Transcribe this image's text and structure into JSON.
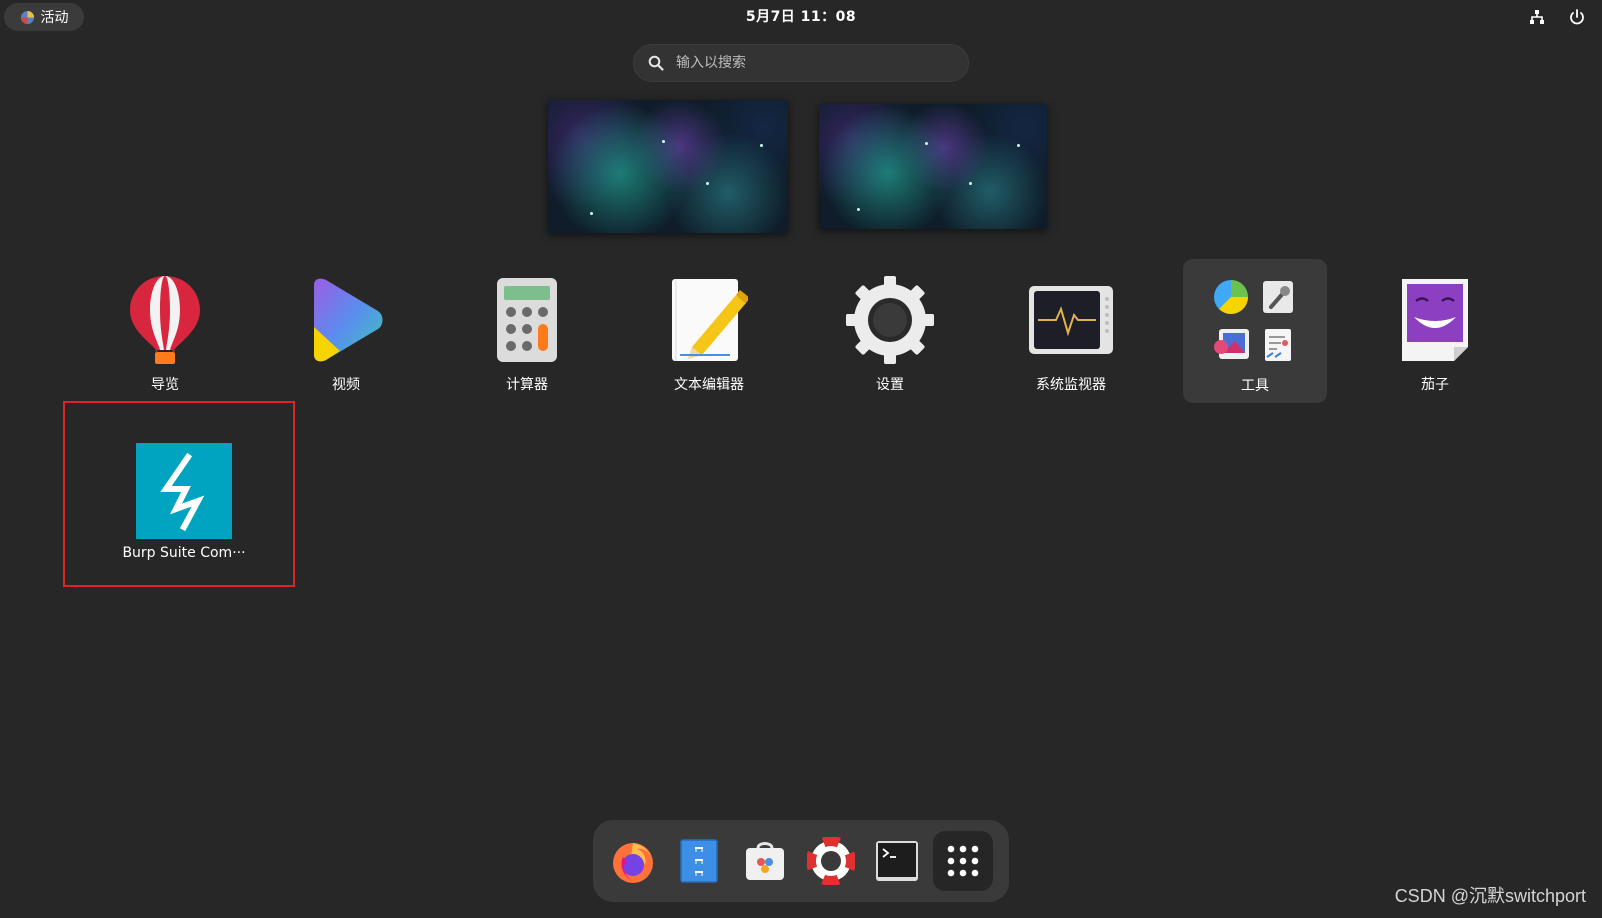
{
  "top_bar": {
    "activities_label": "活动",
    "clock": "5月7日  11：08",
    "icons": [
      "network-icon",
      "power-icon"
    ]
  },
  "search": {
    "placeholder": "输入以搜索",
    "value": ""
  },
  "workspaces": [
    "workspace-1",
    "workspace-2"
  ],
  "apps": [
    {
      "label": "导览",
      "icon": "balloon-icon"
    },
    {
      "label": "视频",
      "icon": "video-play-icon"
    },
    {
      "label": "计算器",
      "icon": "calculator-icon"
    },
    {
      "label": "文本编辑器",
      "icon": "text-editor-icon"
    },
    {
      "label": "设置",
      "icon": "gear-icon"
    },
    {
      "label": "系统监视器",
      "icon": "system-monitor-icon"
    },
    {
      "label": "工具",
      "icon": "folder-icon"
    },
    {
      "label": "茄子",
      "icon": "cheese-icon"
    },
    {
      "label": "Burp Suite Com···",
      "icon": "burp-suite-icon"
    }
  ],
  "dock": {
    "items": [
      "firefox-icon",
      "files-icon",
      "software-icon",
      "help-icon",
      "terminal-icon",
      "show-apps-icon"
    ]
  },
  "colors": {
    "background": "#272727",
    "highlight_border": "#e02424",
    "burp_accent": "#00a4c0"
  },
  "watermark": "CSDN @沉默switchport"
}
